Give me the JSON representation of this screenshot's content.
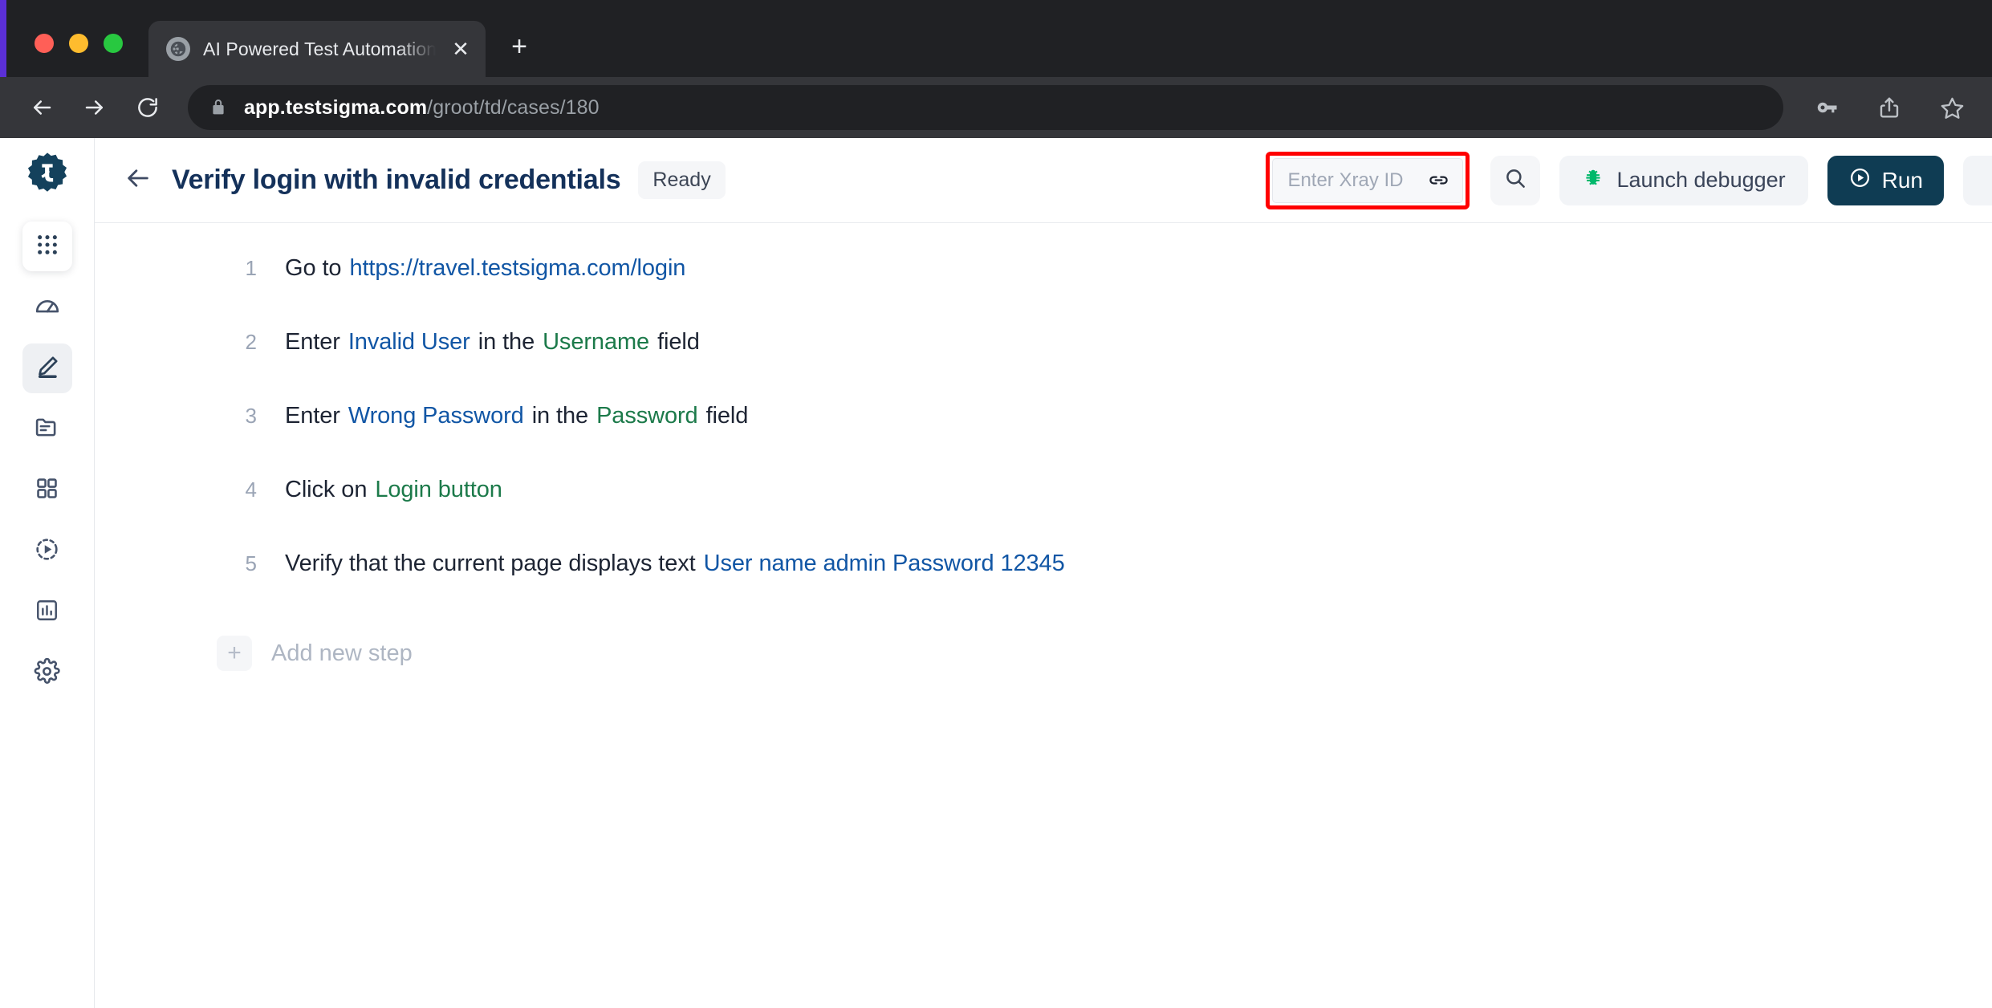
{
  "browser": {
    "tab": {
      "title": "AI Powered Test Automation Pl",
      "favicon_icon": "globe-icon",
      "close_icon": "close-icon"
    },
    "new_tab_icon": "plus-icon",
    "nav": {
      "back_icon": "arrow-left-icon",
      "forward_icon": "arrow-right-icon",
      "reload_icon": "reload-icon"
    },
    "omnibox": {
      "lock_icon": "lock-icon",
      "url_domain": "app.testsigma.com",
      "url_path": "/groot/td/cases/180"
    },
    "toolbar_icons": [
      "key-icon",
      "share-icon",
      "star-icon"
    ]
  },
  "sidebar": {
    "logo": "testsigma-logo",
    "items": [
      {
        "name": "apps-grid",
        "icon": "grid-dots-icon"
      },
      {
        "name": "dashboard",
        "icon": "speedometer-icon"
      },
      {
        "name": "test-development",
        "icon": "pencil-icon"
      },
      {
        "name": "test-data",
        "icon": "folder-icon"
      },
      {
        "name": "test-plans",
        "icon": "squares-icon"
      },
      {
        "name": "runs",
        "icon": "play-circle-dashed-icon"
      },
      {
        "name": "reports",
        "icon": "bar-chart-icon"
      },
      {
        "name": "settings",
        "icon": "gear-icon"
      }
    ]
  },
  "header": {
    "back_icon": "arrow-left-icon",
    "title": "Verify login with invalid credentials",
    "status_badge": "Ready",
    "xray": {
      "placeholder": "Enter Xray ID",
      "value": "",
      "link_icon": "link-icon",
      "highlight_color": "#ff0000"
    },
    "search_icon": "search-icon",
    "debugger": {
      "label": "Launch debugger",
      "icon": "bug-icon",
      "icon_color": "#00b86b"
    },
    "run": {
      "label": "Run",
      "icon": "play-circle-icon",
      "color": "#0f3c53"
    }
  },
  "steps": [
    {
      "number": "1",
      "tokens": [
        {
          "text": "Go to",
          "kind": "plain"
        },
        {
          "text": "https://travel.testsigma.com/login",
          "kind": "data"
        }
      ]
    },
    {
      "number": "2",
      "tokens": [
        {
          "text": "Enter",
          "kind": "plain"
        },
        {
          "text": "Invalid User",
          "kind": "data"
        },
        {
          "text": "in the",
          "kind": "plain"
        },
        {
          "text": "Username",
          "kind": "elem"
        },
        {
          "text": "field",
          "kind": "plain"
        }
      ]
    },
    {
      "number": "3",
      "tokens": [
        {
          "text": "Enter",
          "kind": "plain"
        },
        {
          "text": "Wrong Password",
          "kind": "data"
        },
        {
          "text": "in the",
          "kind": "plain"
        },
        {
          "text": "Password",
          "kind": "elem"
        },
        {
          "text": "field",
          "kind": "plain"
        }
      ]
    },
    {
      "number": "4",
      "tokens": [
        {
          "text": "Click on",
          "kind": "plain"
        },
        {
          "text": "Login button",
          "kind": "elem"
        }
      ]
    },
    {
      "number": "5",
      "tokens": [
        {
          "text": "Verify that the current page displays text",
          "kind": "plain"
        },
        {
          "text": "User name admin Password 12345",
          "kind": "data"
        }
      ]
    }
  ],
  "add_step": {
    "label": "Add new step",
    "icon": "plus-icon"
  }
}
